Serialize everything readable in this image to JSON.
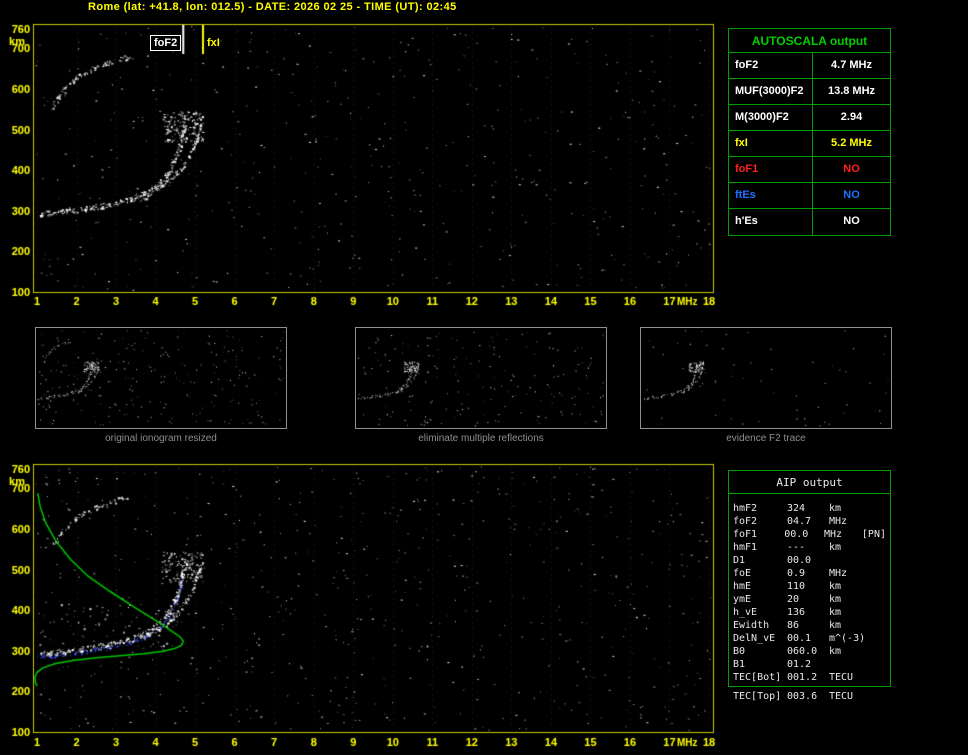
{
  "header": {
    "title": "Rome (lat: +41.8, lon: 012.5) - DATE: 2026 02 25 - TIME (UT): 02:45"
  },
  "autoscala_table": {
    "title": "AUTOSCALA output",
    "rows": [
      {
        "label": "foF2",
        "value": "4.7 MHz",
        "color": "#ffffff"
      },
      {
        "label": "MUF(3000)F2",
        "value": "13.8 MHz",
        "color": "#ffffff"
      },
      {
        "label": "M(3000)F2",
        "value": "2.94",
        "color": "#ffffff"
      },
      {
        "label": "fxI",
        "value": "5.2 MHz",
        "color": "#ffff00"
      },
      {
        "label": "foF1",
        "value": "NO",
        "color": "#ff2020"
      },
      {
        "label": "ftEs",
        "value": "NO",
        "color": "#2070ff"
      },
      {
        "label": "h'Es",
        "value": "NO",
        "color": "#ffffff"
      }
    ]
  },
  "aip_table": {
    "title": "AIP output",
    "rows": [
      {
        "label": "hmF2",
        "value": "324",
        "unit": "km",
        "extra": ""
      },
      {
        "label": "foF2",
        "value": "04.7",
        "unit": "MHz",
        "extra": ""
      },
      {
        "label": "foF1",
        "value": "00.0",
        "unit": "MHz",
        "extra": "[PN]"
      },
      {
        "label": "hmF1",
        "value": "---",
        "unit": "km",
        "extra": ""
      },
      {
        "label": "D1",
        "value": "00.0",
        "unit": "",
        "extra": ""
      },
      {
        "label": "foE",
        "value": "0.9",
        "unit": "MHz",
        "extra": ""
      },
      {
        "label": "hmE",
        "value": "110",
        "unit": "km",
        "extra": ""
      },
      {
        "label": "ymE",
        "value": "20",
        "unit": "km",
        "extra": ""
      },
      {
        "label": "h_vE",
        "value": "136",
        "unit": "km",
        "extra": ""
      },
      {
        "label": "Ewidth",
        "value": "86",
        "unit": "km",
        "extra": ""
      },
      {
        "label": "DelN_vE",
        "value": "00.1",
        "unit": "m^(-3)",
        "extra": ""
      },
      {
        "label": "B0",
        "value": "060.0",
        "unit": "km",
        "extra": ""
      },
      {
        "label": "B1",
        "value": "01.2",
        "unit": "",
        "extra": ""
      },
      {
        "label": "TEC[Bot]",
        "value": "001.2",
        "unit": "TECU",
        "extra": ""
      },
      {
        "label": "TEC[Top]",
        "value": "003.6",
        "unit": "TECU",
        "extra": ""
      }
    ]
  },
  "thumbnails": [
    {
      "caption": "original ionogram resized",
      "series": [
        "second_hop",
        "f2_o",
        "f2_x",
        "cusp"
      ],
      "noise": 240,
      "seed": 5
    },
    {
      "caption": "eliminate multiple reflections",
      "series": [
        "f2_o",
        "f2_x",
        "cusp"
      ],
      "noise": 200,
      "seed": 6
    },
    {
      "caption": "evidence F2 trace",
      "series": [
        "f2_o",
        "f2_x",
        "cusp"
      ],
      "noise": 60,
      "seed": 7
    }
  ],
  "chart_data": [
    {
      "id": "main_ionogram",
      "type": "scatter",
      "title": "",
      "xlabel": "MHz",
      "ylabel": "km",
      "xlim": [
        1,
        18
      ],
      "ylim": [
        100,
        760
      ],
      "x_ticks": [
        1,
        2,
        3,
        4,
        5,
        6,
        7,
        8,
        9,
        10,
        11,
        12,
        13,
        14,
        15,
        16,
        17,
        18
      ],
      "y_ticks": [
        760,
        700,
        600,
        500,
        400,
        300,
        200,
        100
      ],
      "grid": "dotted-vertical",
      "markers": [
        {
          "label": "foF2",
          "freq_mhz": 4.7,
          "color": "#ffffff"
        },
        {
          "label": "fxI",
          "freq_mhz": 5.2,
          "color": "#ffff00"
        }
      ],
      "noise": {
        "seed": 11,
        "count": 520
      },
      "series": [
        {
          "id": "second_hop",
          "name": "F2 second reflection",
          "style": "dots",
          "color": "#ffffff",
          "density": 1.5,
          "spread": 3.2,
          "points": [
            [
              1.35,
              548
            ],
            [
              1.45,
              566
            ],
            [
              1.6,
              590
            ],
            [
              1.8,
              612
            ],
            [
              2.05,
              632
            ],
            [
              2.35,
              649
            ],
            [
              2.65,
              662
            ],
            [
              3.0,
              672
            ],
            [
              3.3,
              679
            ]
          ]
        },
        {
          "id": "f2_o",
          "name": "F2 trace O-mode (foF2 4.7 MHz)",
          "style": "dots",
          "color": "#ffffff",
          "density": 2.3,
          "spread": 3.5,
          "points": [
            [
              1.0,
              293
            ],
            [
              1.5,
              297
            ],
            [
              2.0,
              303
            ],
            [
              2.5,
              310
            ],
            [
              3.0,
              320
            ],
            [
              3.4,
              331
            ],
            [
              3.7,
              343
            ],
            [
              3.95,
              357
            ],
            [
              4.15,
              373
            ],
            [
              4.3,
              391
            ],
            [
              4.42,
              412
            ],
            [
              4.52,
              436
            ],
            [
              4.6,
              460
            ],
            [
              4.66,
              484
            ],
            [
              4.71,
              508
            ],
            [
              4.74,
              524
            ]
          ]
        },
        {
          "id": "f2_x",
          "name": "F2 trace X-mode (fxI 5.2 MHz)",
          "style": "dots",
          "color": "#ffffff",
          "density": 1.7,
          "spread": 3.0,
          "points": [
            [
              3.6,
              330
            ],
            [
              3.9,
              344
            ],
            [
              4.15,
              360
            ],
            [
              4.38,
              378
            ],
            [
              4.58,
              398
            ],
            [
              4.75,
              420
            ],
            [
              4.9,
              445
            ],
            [
              5.0,
              468
            ],
            [
              5.08,
              492
            ],
            [
              5.14,
              514
            ]
          ]
        },
        {
          "id": "cusp",
          "name": "F2 cusp spread",
          "style": "cluster",
          "color": "#ffffff",
          "box": [
            4.15,
            5.2,
            470,
            545
          ],
          "count": 150
        }
      ]
    },
    {
      "id": "profile_ionogram",
      "type": "scatter",
      "title": "",
      "xlabel": "MHz",
      "ylabel": "km",
      "xlim": [
        1,
        18
      ],
      "ylim": [
        100,
        760
      ],
      "x_ticks": [
        1,
        2,
        3,
        4,
        5,
        6,
        7,
        8,
        9,
        10,
        11,
        12,
        13,
        14,
        15,
        16,
        17,
        18
      ],
      "y_ticks": [
        760,
        700,
        600,
        500,
        400,
        300,
        200,
        100
      ],
      "grid": "dotted-vertical",
      "markers": [],
      "noise": {
        "seed": 23,
        "count": 680
      },
      "series": [
        {
          "id": "second_hop",
          "name": "F2 second reflection",
          "style": "dots",
          "color": "#ffffff",
          "density": 1.2,
          "spread": 3.0,
          "points": [
            [
              1.35,
              548
            ],
            [
              1.45,
              566
            ],
            [
              1.6,
              590
            ],
            [
              1.8,
              612
            ],
            [
              2.05,
              632
            ],
            [
              2.35,
              649
            ],
            [
              2.65,
              662
            ],
            [
              3.0,
              672
            ],
            [
              3.3,
              679
            ]
          ]
        },
        {
          "id": "restored",
          "name": "restored trace",
          "style": "dots",
          "color": "#3a50ff",
          "density": 1.5,
          "spread": 2.4,
          "points": [
            [
              1.0,
              286
            ],
            [
              1.5,
              290
            ],
            [
              2.0,
              296
            ],
            [
              2.5,
              303
            ],
            [
              3.0,
              312
            ],
            [
              3.4,
              323
            ],
            [
              3.7,
              335
            ],
            [
              3.95,
              349
            ],
            [
              4.15,
              365
            ],
            [
              4.3,
              383
            ],
            [
              4.42,
              404
            ],
            [
              4.52,
              428
            ],
            [
              4.6,
              452
            ],
            [
              4.66,
              476
            ]
          ]
        },
        {
          "id": "stray",
          "name": "stray echoes",
          "style": "cluster",
          "color": "#ffffff",
          "box": [
            1.0,
            4.6,
            300,
            420
          ],
          "count": 60
        },
        {
          "id": "f2_o",
          "name": "F2 trace O-mode",
          "style": "dots",
          "color": "#ffffff",
          "density": 2.3,
          "spread": 3.5,
          "points": [
            [
              1.0,
              293
            ],
            [
              1.5,
              297
            ],
            [
              2.0,
              303
            ],
            [
              2.5,
              310
            ],
            [
              3.0,
              320
            ],
            [
              3.4,
              331
            ],
            [
              3.7,
              343
            ],
            [
              3.95,
              357
            ],
            [
              4.15,
              373
            ],
            [
              4.3,
              391
            ],
            [
              4.42,
              412
            ],
            [
              4.52,
              436
            ],
            [
              4.6,
              460
            ],
            [
              4.66,
              484
            ],
            [
              4.71,
              508
            ],
            [
              4.74,
              524
            ]
          ]
        },
        {
          "id": "f2_x",
          "name": "F2 trace X-mode",
          "style": "dots",
          "color": "#ffffff",
          "density": 1.7,
          "spread": 3.0,
          "points": [
            [
              3.6,
              330
            ],
            [
              3.9,
              344
            ],
            [
              4.15,
              360
            ],
            [
              4.38,
              378
            ],
            [
              4.58,
              398
            ],
            [
              4.75,
              420
            ],
            [
              4.9,
              445
            ],
            [
              5.0,
              468
            ],
            [
              5.08,
              492
            ],
            [
              5.14,
              514
            ]
          ]
        },
        {
          "id": "cusp",
          "name": "F2 cusp spread",
          "style": "cluster",
          "color": "#ffffff",
          "box": [
            4.15,
            5.2,
            470,
            545
          ],
          "count": 120
        },
        {
          "id": "profile",
          "name": "electron density profile (hmF2 324 km, foF2 4.7 MHz)",
          "style": "line",
          "color": "#00c400",
          "width": 1.5,
          "points": [
            [
              1.02,
              688
            ],
            [
              1.08,
              655
            ],
            [
              1.22,
              615
            ],
            [
              1.48,
              570
            ],
            [
              1.85,
              525
            ],
            [
              2.3,
              483
            ],
            [
              2.85,
              446
            ],
            [
              3.45,
              408
            ],
            [
              4.0,
              375
            ],
            [
              4.4,
              349
            ],
            [
              4.62,
              334
            ],
            [
              4.7,
              324
            ],
            [
              4.66,
              314
            ],
            [
              4.5,
              306
            ],
            [
              4.2,
              299
            ],
            [
              3.7,
              293
            ],
            [
              3.1,
              288
            ],
            [
              2.5,
              283
            ],
            [
              1.9,
              276
            ],
            [
              1.45,
              268
            ],
            [
              1.15,
              258
            ],
            [
              1.0,
              247
            ],
            [
              0.95,
              236
            ],
            [
              0.96,
              222
            ],
            [
              1.0,
              213
            ]
          ]
        }
      ]
    }
  ]
}
